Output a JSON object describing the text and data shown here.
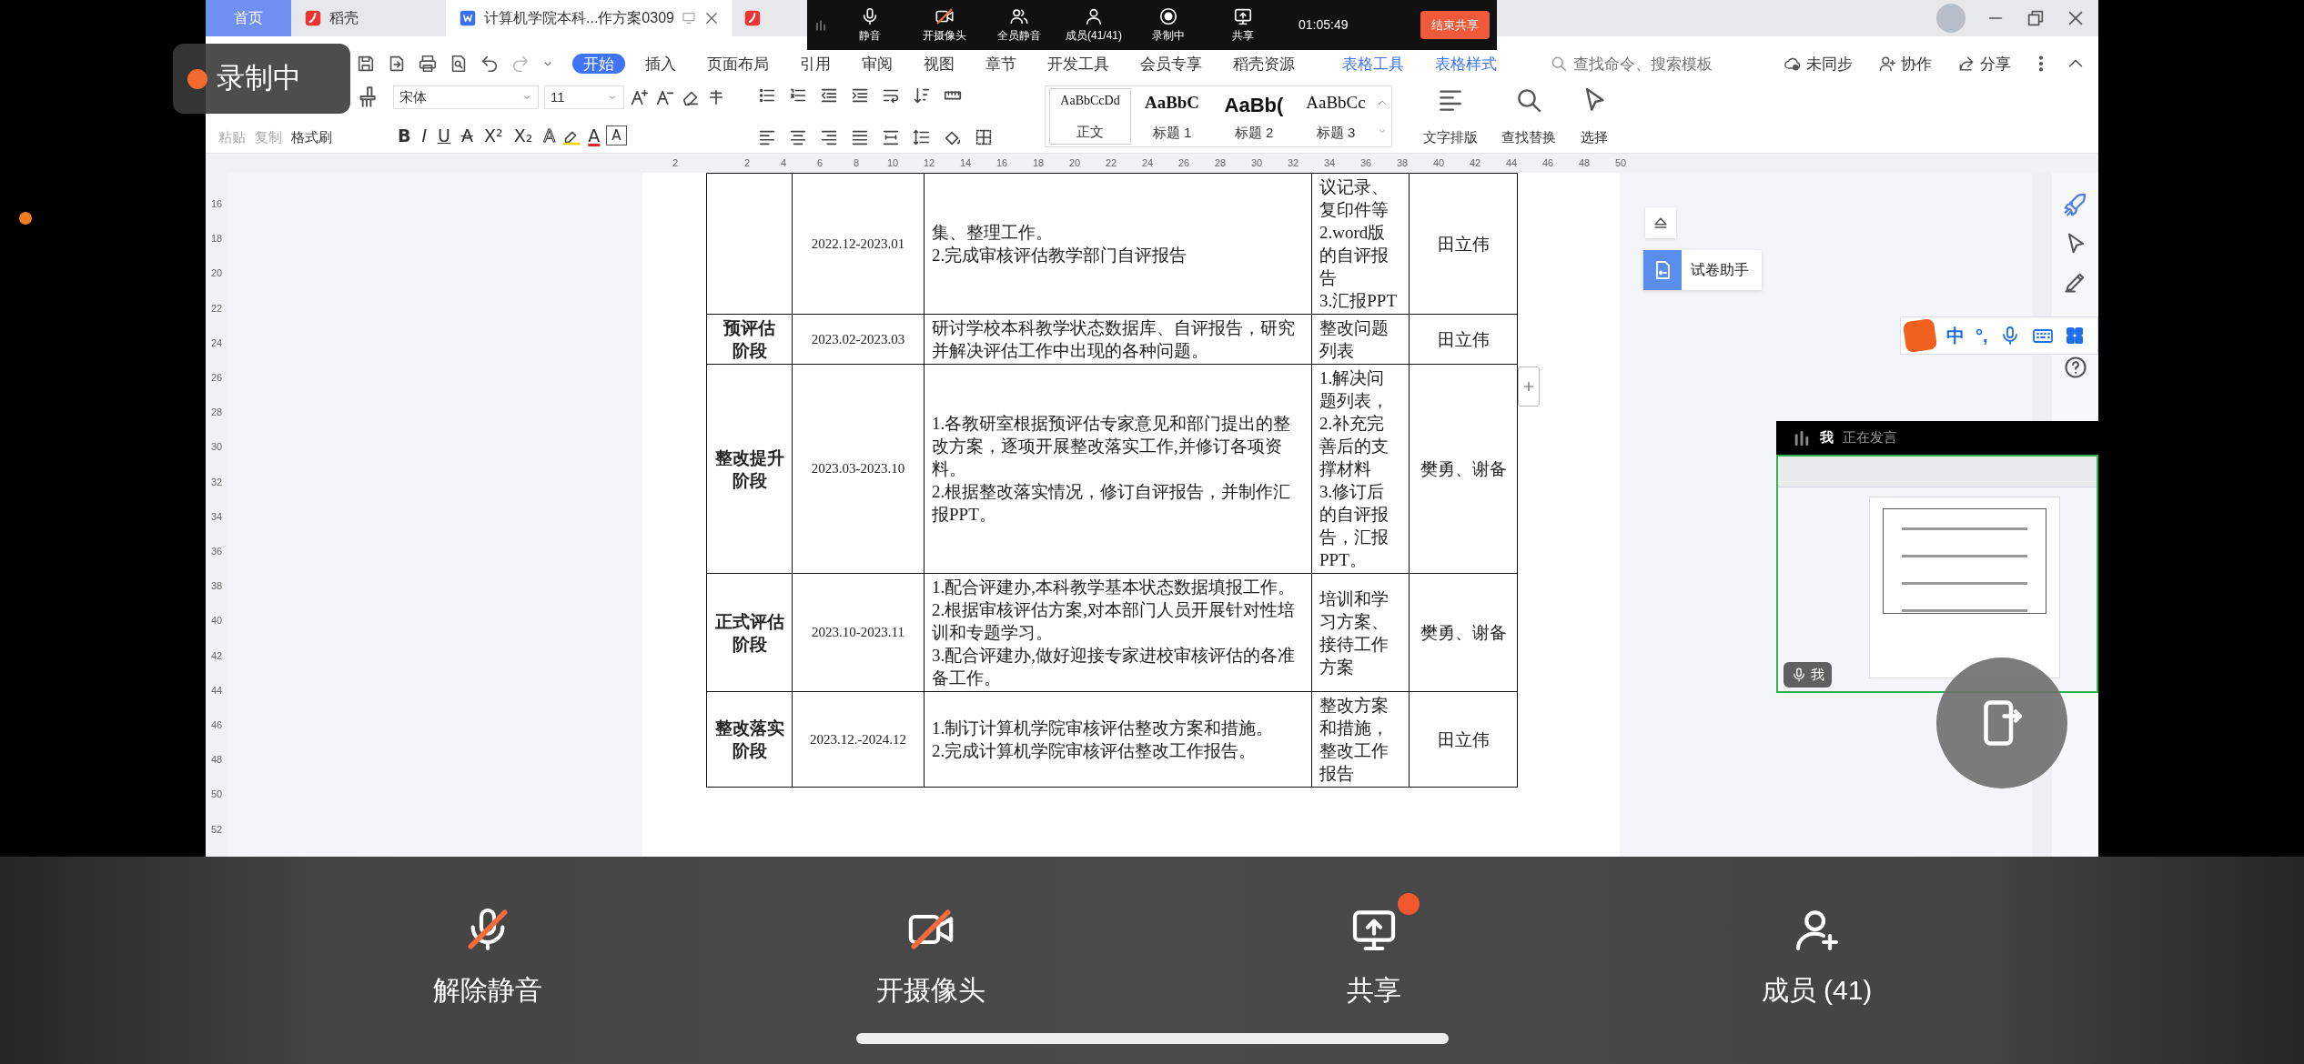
{
  "tabs": [
    {
      "label": "首页",
      "kind": "home",
      "selected": false
    },
    {
      "label": "稻壳",
      "kind": "docer",
      "selected": false
    },
    {
      "label": "计算机学院本科...作方案0309",
      "kind": "doc",
      "selected": true
    }
  ],
  "meeting_toolbar": {
    "items": [
      {
        "label": "静音"
      },
      {
        "label": "开摄像头"
      },
      {
        "label": "全员静音"
      },
      {
        "label": "成员(41/41)"
      },
      {
        "label": "录制中"
      },
      {
        "label": "共享"
      }
    ],
    "time": "01:05:49",
    "end_button": "结束共享"
  },
  "recording_badge": {
    "label": "录制中"
  },
  "menu": [
    {
      "label": "开始",
      "kind": "tab",
      "selected": true
    },
    {
      "label": "插入",
      "kind": "tab",
      "selected": false
    },
    {
      "label": "页面布局",
      "kind": "tab",
      "selected": false
    },
    {
      "label": "引用",
      "kind": "tab",
      "selected": false
    },
    {
      "label": "审阅",
      "kind": "tab",
      "selected": false
    },
    {
      "label": "视图",
      "kind": "tab",
      "selected": false
    },
    {
      "label": "章节",
      "kind": "tab",
      "selected": false
    },
    {
      "label": "开发工具",
      "kind": "tab",
      "selected": false
    },
    {
      "label": "会员专享",
      "kind": "tab",
      "selected": false
    },
    {
      "label": "稻壳资源",
      "kind": "tab",
      "selected": false
    },
    {
      "label": "表格工具",
      "kind": "context",
      "selected": false
    },
    {
      "label": "表格样式",
      "kind": "context",
      "selected": false
    }
  ],
  "search": {
    "placeholder": "查找命令、搜索模板"
  },
  "header_actions": [
    {
      "label": "未同步"
    },
    {
      "label": "协作"
    },
    {
      "label": "分享"
    }
  ],
  "toolbar": {
    "clipboard": [
      {
        "label": "粘贴",
        "disabled": true
      },
      {
        "label": "复制",
        "disabled": true
      }
    ],
    "format_painter": "格式刷",
    "font": "宋体",
    "size": "11",
    "format_glyphs": [
      {
        "glyph": "B",
        "kind": "bold"
      },
      {
        "glyph": "I",
        "kind": "italic"
      },
      {
        "glyph": "U",
        "kind": "underline"
      },
      {
        "glyph": "A",
        "kind": "strike"
      },
      {
        "glyph": "X²",
        "kind": "plain"
      },
      {
        "glyph": "X₂",
        "kind": "plain"
      },
      {
        "glyph": "A",
        "kind": "outline"
      },
      {
        "glyph": "A",
        "kind": "fontcolor"
      },
      {
        "glyph": "A",
        "kind": "boxed"
      }
    ],
    "styles": [
      {
        "preview": "AaBbCcDd",
        "label": "正文",
        "kind": "body",
        "selected": true
      },
      {
        "preview": "AaBbC",
        "label": "标题 1",
        "kind": "h1",
        "selected": false
      },
      {
        "preview": "AaBb(",
        "label": "标题 2",
        "kind": "h2",
        "selected": false
      },
      {
        "preview": "AaBbCc",
        "label": "标题 3",
        "kind": "h3",
        "selected": false
      }
    ],
    "tools": [
      {
        "label": "文字排版"
      },
      {
        "label": "查找替换"
      },
      {
        "label": "选择"
      }
    ]
  },
  "ruler": [
    "2",
    "2",
    "4",
    "6",
    "8",
    "10",
    "12",
    "14",
    "16",
    "18",
    "20",
    "22",
    "24",
    "26",
    "28",
    "30",
    "32",
    "34",
    "36",
    "38",
    "40",
    "42",
    "44",
    "46",
    "48",
    "50"
  ],
  "vertical_ruler": [
    "16",
    "18",
    "20",
    "22",
    "24",
    "26",
    "28",
    "30",
    "32",
    "34",
    "36",
    "38",
    "40",
    "42",
    "44",
    "46",
    "48",
    "50",
    "52"
  ],
  "table": {
    "rows": [
      {
        "period": "2022.12-2023.01",
        "content": [
          "集、整理工作。",
          "2.完成审核评估教学部门自评报告"
        ],
        "output": [
          "议记录、复印件等",
          "2.word版的自评报告",
          "3.汇报PPT"
        ],
        "owner": "田立伟"
      },
      {
        "stage": "预评估阶段",
        "period": "2023.02-2023.03",
        "content": [
          "研讨学校本科教学状态数据库、自评报告，研究并解决评估工作中出现的各种问题。"
        ],
        "output": [
          "整改问题列表"
        ],
        "owner": "田立伟"
      },
      {
        "stage": "整改提升阶段",
        "period": "2023.03-2023.10",
        "content": [
          "1.各教研室根据预评估专家意见和部门提出的整改方案，逐项开展整改落实工作,并修订各项资料。",
          "2.根据整改落实情况，修订自评报告，并制作汇报PPT。"
        ],
        "output": [
          "1.解决问题列表，",
          "2.补充完善后的支撑材料",
          "3.修订后的自评报告，汇报PPT。"
        ],
        "owner": "樊勇、谢备"
      },
      {
        "stage": "正式评估阶段",
        "period": "2023.10-2023.11",
        "content": [
          "1.配合评建办,本科教学基本状态数据填报工作。",
          "2.根据审核评估方案,对本部门人员开展针对性培训和专题学习。",
          "3.配合评建办,做好迎接专家进校审核评估的各准备工作。"
        ],
        "output": [
          "培训和学习方案、接待工作方案"
        ],
        "owner": "樊勇、谢备"
      },
      {
        "stage": "整改落实阶段",
        "period": "2023.12.-2024.12",
        "content": [
          "1.制订计算机学院审核评估整改方案和措施。",
          "2.完成计算机学院审核评估整改工作报告。"
        ],
        "output": [
          "整改方案和措施，整改工作报告"
        ],
        "owner": "田立伟"
      }
    ]
  },
  "side_panel": {
    "assistant": "试卷助手"
  },
  "ime": {
    "mode": "中",
    "punctuation": "°,"
  },
  "speaker": {
    "name": "我",
    "status": "正在发言",
    "mic_label": "我"
  },
  "bottom_bar": [
    {
      "label": "解除静音",
      "notification": false
    },
    {
      "label": "开摄像头",
      "notification": false
    },
    {
      "label": "共享",
      "notification": true
    },
    {
      "label": "成员 (41)",
      "notification": false
    }
  ]
}
